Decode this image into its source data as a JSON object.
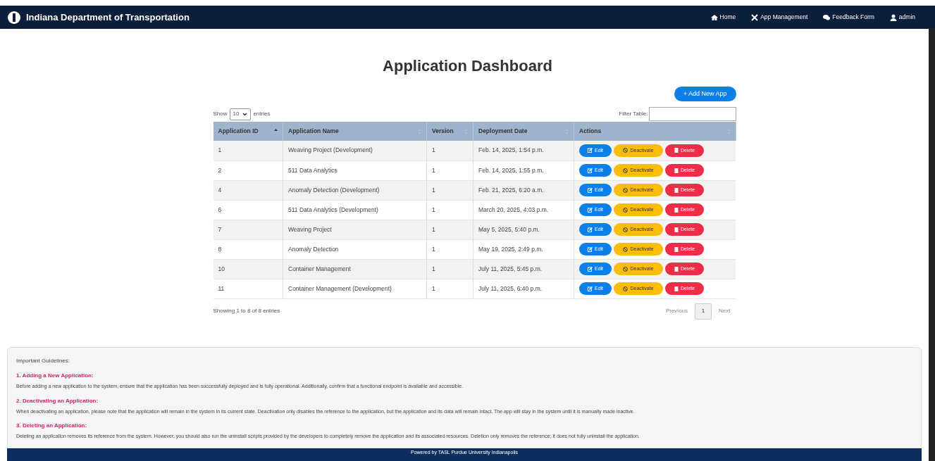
{
  "navbar": {
    "brand": "Indiana Department of Transportation",
    "links": [
      {
        "kind": "home",
        "label": "Home"
      },
      {
        "kind": "tools",
        "label": "App Management"
      },
      {
        "kind": "chat",
        "label": "Feedback Form"
      },
      {
        "kind": "user",
        "label": "admin"
      }
    ]
  },
  "page_title": "Application Dashboard",
  "add_button": "+ Add New App",
  "length_control": {
    "before": "Show",
    "value": "10",
    "after": "entries"
  },
  "filter": {
    "label": "Filter Table:"
  },
  "table": {
    "columns": [
      {
        "label": "Application ID",
        "sorted": true
      },
      {
        "label": "Application Name",
        "sorted": false
      },
      {
        "label": "Version",
        "sorted": false
      },
      {
        "label": "Deployment Date",
        "sorted": false
      },
      {
        "label": "Actions",
        "sorted": false
      }
    ],
    "rows": [
      {
        "id": "1",
        "name": "Weaving Project (Development)",
        "version": "1",
        "date": "Feb. 14, 2025, 1:54 p.m.",
        "actions": [
          {
            "kind": "edit",
            "label": "Edit"
          },
          {
            "kind": "deactivate",
            "label": "Deactivate"
          },
          {
            "kind": "delete",
            "label": "Delete"
          }
        ]
      },
      {
        "id": "2",
        "name": "511 Data Analytics",
        "version": "1",
        "date": "Feb. 14, 2025, 1:55 p.m.",
        "actions": [
          {
            "kind": "edit",
            "label": "Edit"
          },
          {
            "kind": "deactivate",
            "label": "Deactivate"
          },
          {
            "kind": "delete",
            "label": "Delete"
          }
        ]
      },
      {
        "id": "4",
        "name": "Anomaly Detection (Development)",
        "version": "1",
        "date": "Feb. 21, 2025, 6:20 a.m.",
        "actions": [
          {
            "kind": "edit",
            "label": "Edit"
          },
          {
            "kind": "deactivate",
            "label": "Deactivate"
          },
          {
            "kind": "delete",
            "label": "Delete"
          }
        ]
      },
      {
        "id": "6",
        "name": "511 Data Analytics (Development)",
        "version": "1",
        "date": "March 20, 2025, 4:03 p.m.",
        "actions": [
          {
            "kind": "edit",
            "label": "Edit"
          },
          {
            "kind": "deactivate",
            "label": "Deactivate"
          },
          {
            "kind": "delete",
            "label": "Delete"
          }
        ]
      },
      {
        "id": "7",
        "name": "Weaving Project",
        "version": "1",
        "date": "May 5, 2025, 5:40 p.m.",
        "actions": [
          {
            "kind": "edit",
            "label": "Edit"
          },
          {
            "kind": "deactivate",
            "label": "Deactivate"
          },
          {
            "kind": "delete",
            "label": "Delete"
          }
        ]
      },
      {
        "id": "8",
        "name": "Anomaly Detection",
        "version": "1",
        "date": "May 19, 2025, 2:49 p.m.",
        "actions": [
          {
            "kind": "edit",
            "label": "Edit"
          },
          {
            "kind": "deactivate",
            "label": "Deactivate"
          },
          {
            "kind": "delete",
            "label": "Delete"
          }
        ]
      },
      {
        "id": "10",
        "name": "Container Management",
        "version": "1",
        "date": "July 11, 2025, 5:45 p.m.",
        "actions": [
          {
            "kind": "edit",
            "label": "Edit"
          },
          {
            "kind": "deactivate",
            "label": "Deactivate"
          },
          {
            "kind": "delete",
            "label": "Delete"
          }
        ]
      },
      {
        "id": "11",
        "name": "Container Management (Development)",
        "version": "1",
        "date": "July 11, 2025, 6:40 p.m.",
        "actions": [
          {
            "kind": "edit",
            "label": "Edit"
          },
          {
            "kind": "deactivate",
            "label": "Deactivate"
          },
          {
            "kind": "delete",
            "label": "Delete"
          }
        ]
      }
    ]
  },
  "info": "Showing 1 to 8 of 8 entries",
  "pagination": {
    "previous": "Previous",
    "pages": [
      {
        "label": "1",
        "selected": true
      }
    ],
    "next": "Next"
  },
  "guidelines": {
    "title": "Important Guidelines:",
    "sections": [
      {
        "heading": "1. Adding a New Application:",
        "text": "Before adding a new application to the system, ensure that the application has been successfully deployed and is fully operational. Additionally, confirm that a functional endpoint is available and accessible."
      },
      {
        "heading": "2. Deactivating an Application:",
        "text": "When deactivating an application, please note that the application will remain in the system in its current state. Deactivation only disables the reference to the application, but the application and its data will remain intact. The app will stay in the system until it is manually made inactive."
      },
      {
        "heading": "3. Deleting an Application:",
        "text": "Deleting an application removes its reference from the system. However, you should also run the uninstall scripts provided by the developers to completely remove the application and its associated resources. Deletion only removes the reference; it does not fully uninstall the application."
      }
    ]
  },
  "footer": "Powered by TASL Purdue University Indianapolis"
}
